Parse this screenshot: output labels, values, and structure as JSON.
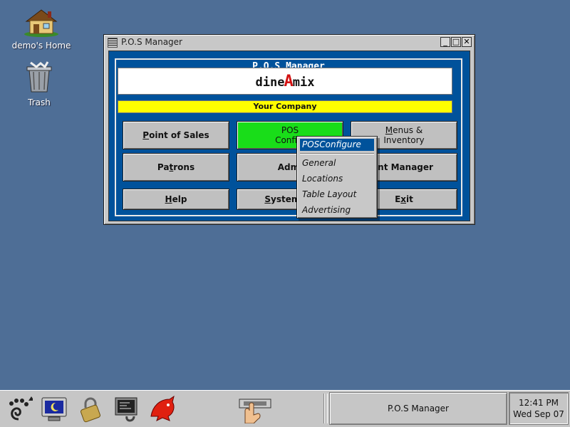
{
  "desktop": {
    "icons": [
      {
        "label": "demo's Home",
        "icon": "house-icon"
      },
      {
        "label": "Trash",
        "icon": "trash-icon"
      }
    ]
  },
  "window": {
    "title": "P.O.S Manager",
    "controls": {
      "minimize": "_",
      "maximize": "□",
      "close": "✕"
    },
    "group_title": "P.O.S Manager",
    "logo": {
      "left": "dine",
      "mark": "A",
      "right": "mix"
    },
    "company": "Your Company",
    "buttons": {
      "point_of_sales": {
        "pre": "",
        "u": "P",
        "post": "oint of Sales"
      },
      "pos_config": {
        "line1": "POS",
        "line2": "Configi"
      },
      "menus_inventory": {
        "line1_u": "M",
        "line1_rest": "enus &",
        "line2": "Inventory"
      },
      "patrons": {
        "pre": "Pa",
        "u": "t",
        "post": "rons"
      },
      "admin": "Admi",
      "point_manager": "int Manager",
      "help": {
        "u": "H",
        "post": "elp"
      },
      "system": {
        "u": "S",
        "post": "ystem Co"
      },
      "exit": {
        "pre": "E",
        "u": "x",
        "post": "it"
      }
    }
  },
  "popup_menu": {
    "title": "POSConfigure",
    "items": [
      "General",
      "Locations",
      "Table Layout",
      "Advertising"
    ]
  },
  "taskbar": {
    "task_label": "P.O.S Manager",
    "clock_time": "12:41 PM",
    "clock_date": "Wed Sep 07"
  },
  "colors": {
    "desktop": "#4e6e96",
    "client": "#00529b",
    "company_bar": "#ffff00",
    "active_button": "#19dd19"
  }
}
